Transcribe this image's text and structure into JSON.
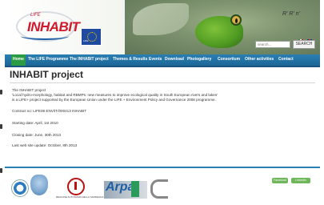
{
  "header": {
    "logo_small": "LIFE",
    "logo_main": "INHABIT",
    "eu_label": "LIFE",
    "top_lang": "R' R' n'",
    "search_placeholder": "search...",
    "search_button": "SEARCH"
  },
  "nav": {
    "items": [
      {
        "label": "Home",
        "active": true
      },
      {
        "label": "The LIFE Programme",
        "active": false
      },
      {
        "label": "The INHABIT project",
        "active": false
      },
      {
        "label": "Themes & Results",
        "active": false
      },
      {
        "label": "Events",
        "active": false
      },
      {
        "label": "Download",
        "active": false
      },
      {
        "label": "Photogallery",
        "active": false
      },
      {
        "label": "Consortium",
        "active": false
      },
      {
        "label": "Other activities",
        "active": false
      },
      {
        "label": "Contact",
        "active": false
      }
    ]
  },
  "content": {
    "title": "INHABIT project",
    "lines": [
      "The INHABIT project",
      "'Local hydro-morphology, habitat and RBMPs: new measures to improve ecological quality in South European rivers and lakes'",
      "is a LIFE+ project supported by the European Union under the LIFE + Environment Policy and Governance 2008 programme.",
      "Contract no: LIFE08 ENV/IT/000413 INHABIT",
      "Starting date: April, 1st 2010",
      "Closing date: June, 30th 2013",
      "Last web site update: October, 8th 2013"
    ]
  },
  "footer": {
    "sardinia_text": "REGIONE AUTONOMA DELLA SARDEGNA",
    "arpa_text": "Arpa",
    "social_1": "Facebook",
    "social_2": "Linkedin"
  },
  "colors": {
    "nav_bg": "#1d6697",
    "nav_active": "#2c9b45",
    "brand_red": "#d0192b"
  }
}
